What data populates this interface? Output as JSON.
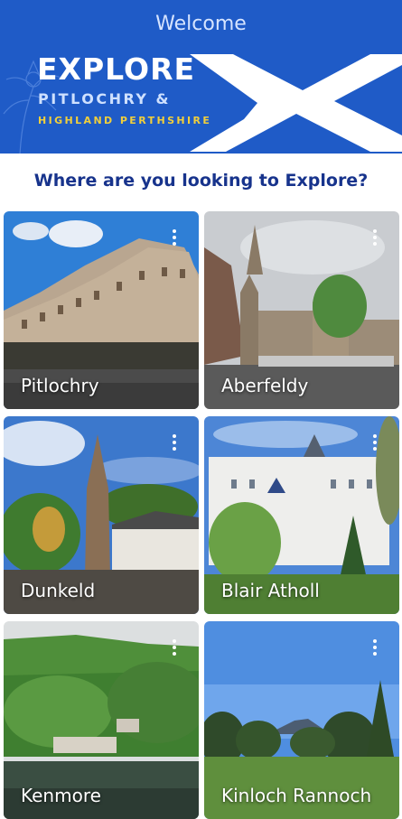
{
  "header": {
    "welcome": "Welcome",
    "logo_line1": "EXPLORE",
    "logo_line2": "PITLOCHRY &",
    "logo_line3": "HIGHLAND PERTHSHIRE",
    "brand_blue": "#1f5bc7",
    "accent_yellow": "#f1cf3b"
  },
  "question": "Where are you looking to Explore?",
  "locations": [
    {
      "name": "Pitlochry",
      "icon": "more-vert-icon"
    },
    {
      "name": "Aberfeldy",
      "icon": "more-vert-icon"
    },
    {
      "name": "Dunkeld",
      "icon": "more-vert-icon"
    },
    {
      "name": "Blair Atholl",
      "icon": "more-vert-icon"
    },
    {
      "name": "Kenmore",
      "icon": "more-vert-icon"
    },
    {
      "name": "Kinloch Rannoch",
      "icon": "more-vert-icon"
    }
  ]
}
